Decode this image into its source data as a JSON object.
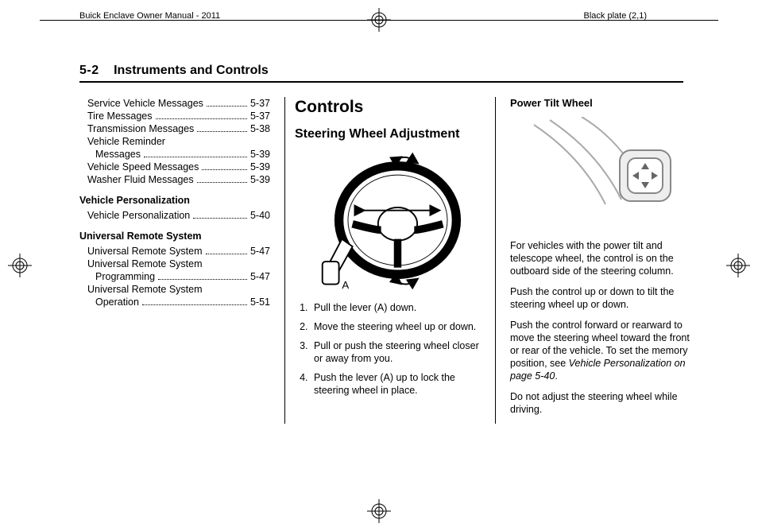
{
  "running_head": {
    "left": "Buick Enclave Owner Manual - 2011",
    "right": "Black plate (2,1)"
  },
  "section": {
    "page_num": "5-2",
    "title": "Instruments and Controls"
  },
  "toc": {
    "items_a": [
      {
        "label": "Service Vehicle Messages",
        "page": "5-37"
      },
      {
        "label": "Tire Messages",
        "page": "5-37"
      },
      {
        "label": "Transmission Messages",
        "page": "5-38"
      }
    ],
    "vrm_line1": "Vehicle Reminder",
    "vrm_line2": "Messages",
    "vrm_page": "5-39",
    "items_b": [
      {
        "label": "Vehicle Speed Messages",
        "page": "5-39"
      },
      {
        "label": "Washer Fluid Messages",
        "page": "5-39"
      }
    ],
    "head_vp": "Vehicle Personalization",
    "vp_item": {
      "label": "Vehicle Personalization",
      "page": "5-40"
    },
    "head_urs": "Universal Remote System",
    "urs_item1": {
      "label": "Universal Remote System",
      "page": "5-47"
    },
    "urs_p_line1": "Universal Remote System",
    "urs_p_line2": "Programming",
    "urs_p_page": "5-47",
    "urs_o_line1": "Universal Remote System",
    "urs_o_line2": "Operation",
    "urs_o_page": "5-51"
  },
  "controls": {
    "h2": "Controls",
    "h3": "Steering Wheel Adjustment",
    "caption_letter": "A",
    "steps": [
      "Pull the lever (A) down.",
      "Move the steering wheel up or down.",
      "Pull or push the steering wheel closer or away from you.",
      "Push the lever (A) up to lock the steering wheel in place."
    ]
  },
  "power_tilt": {
    "h4": "Power Tilt Wheel",
    "p1": "For vehicles with the power tilt and telescope wheel, the control is on the outboard side of the steering column.",
    "p2": "Push the control up or down to tilt the steering wheel up or down.",
    "p3a": "Push the control forward or rearward to move the steering wheel toward the front or rear of the vehicle. To set the memory position, see ",
    "p3b_ital": "Vehicle Personalization on page 5-40",
    "p3c": ".",
    "p4": "Do not adjust the steering wheel while driving."
  }
}
